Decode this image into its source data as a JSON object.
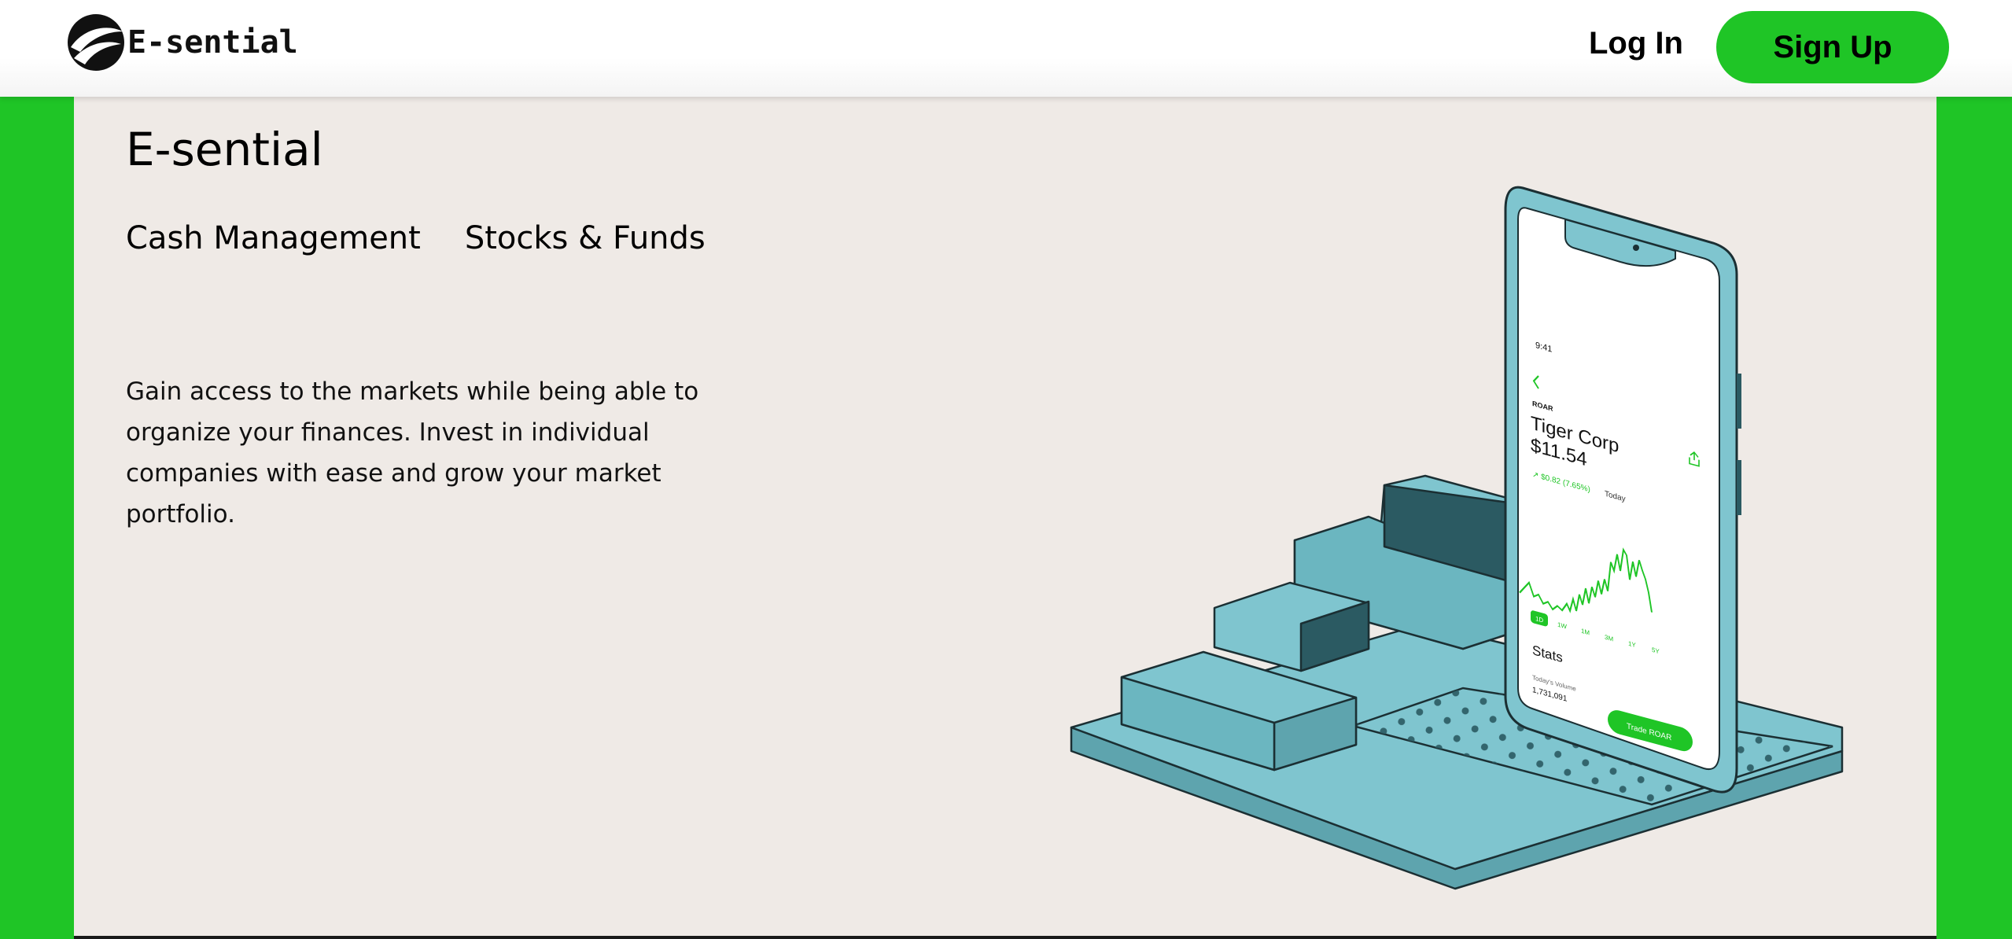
{
  "nav": {
    "brand_name": "E-sential",
    "login_label": "Log In",
    "signup_label": "Sign Up"
  },
  "hero": {
    "title": "E-sential",
    "tabs": [
      {
        "label": "Cash Management"
      },
      {
        "label": "Stocks & Funds"
      }
    ],
    "description": "Gain access to the markets while being able to organize your finances. Invest in individual companies with ease and grow your market portfolio."
  },
  "phone": {
    "time": "9:41",
    "ticker": "ROAR",
    "company": "Tiger Corp",
    "price": "$11.54",
    "change": "↗ $0.82 (7.65%)",
    "change_period": "Today",
    "ranges": [
      "1D",
      "1W",
      "1M",
      "3M",
      "1Y",
      "5Y"
    ],
    "stats_title": "Stats",
    "volume_label": "Today's Volume",
    "volume_value": "1,731,091",
    "trade_label": "Trade ROAR"
  },
  "colors": {
    "brand_green": "#1fc526",
    "page_bg": "#efeae6",
    "illustration_teal": "#7fc5cf",
    "illustration_shadow": "#2b5a62"
  }
}
